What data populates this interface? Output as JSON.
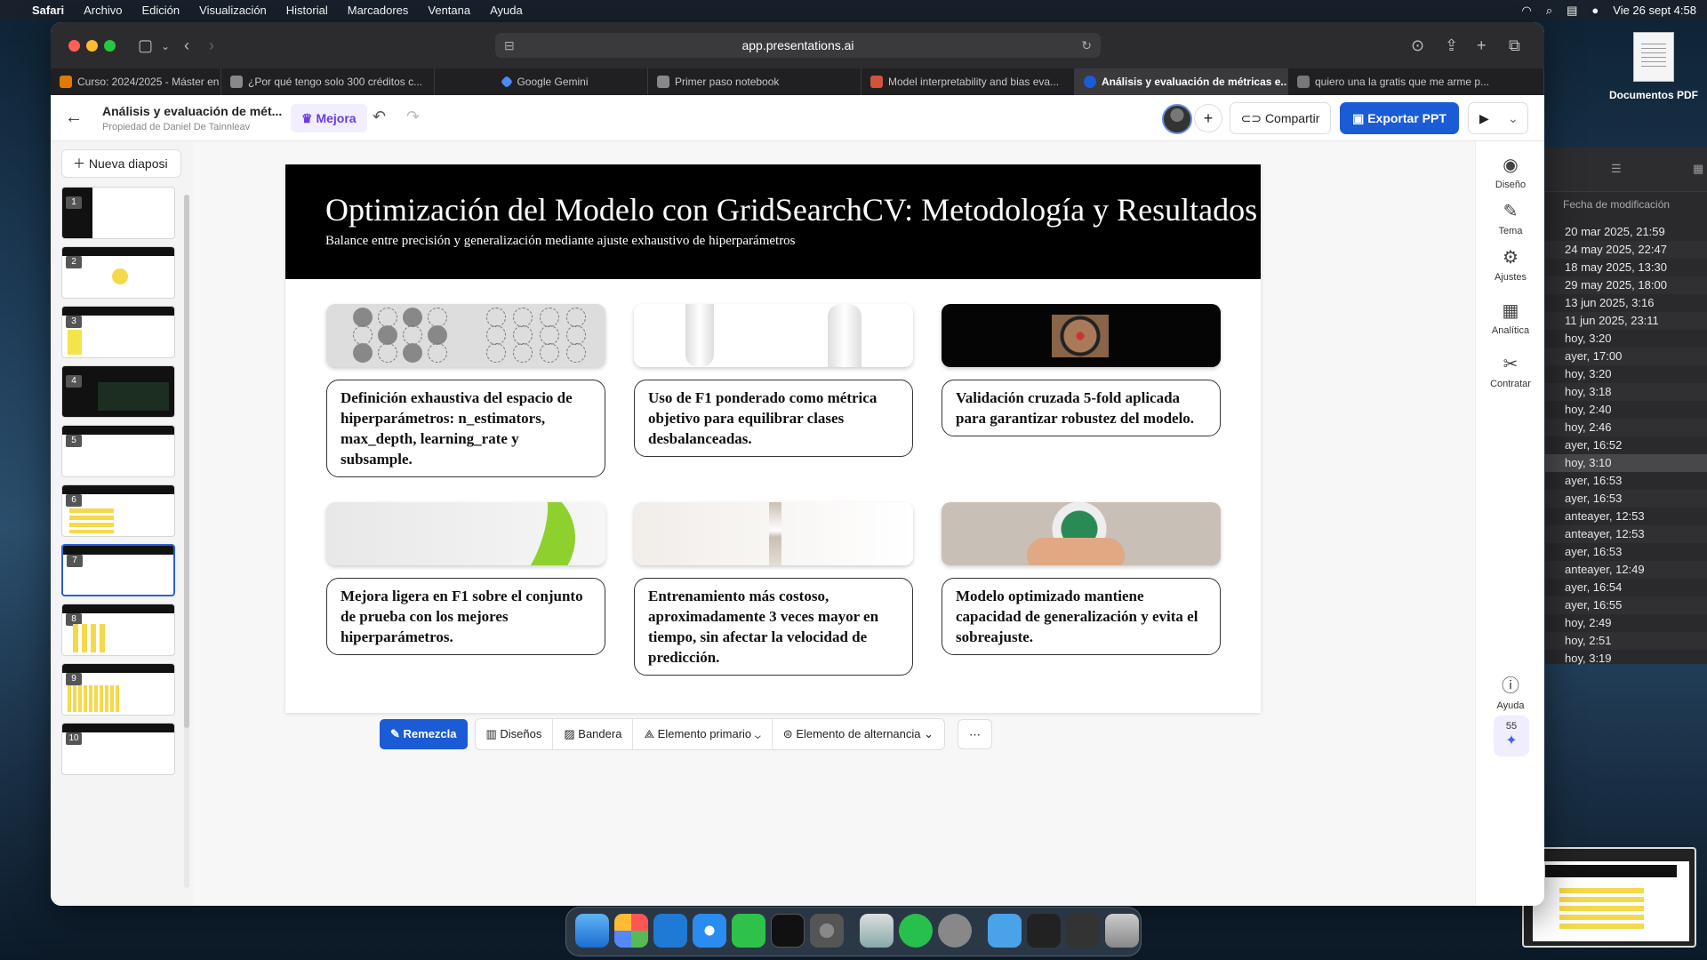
{
  "menubar": {
    "apple": "",
    "items": [
      "Safari",
      "Archivo",
      "Edición",
      "Visualización",
      "Historial",
      "Marcadores",
      "Ventana",
      "Ayuda"
    ],
    "datetime": "Vie 26 sept 4:58"
  },
  "desktop": {
    "file_label": "Documentos PDF"
  },
  "finder": {
    "column": "Fecha de modificación",
    "rows": [
      "20 mar 2025, 21:59",
      "24 may 2025, 22:47",
      "18 may 2025, 13:30",
      "29 may 2025, 18:00",
      "13 jun 2025, 3:16",
      "11 jun 2025, 23:11",
      "hoy, 3:20",
      "ayer, 17:00",
      "hoy, 3:20",
      "hoy, 3:18",
      "hoy, 2:40",
      "hoy, 2:46",
      "ayer, 16:52",
      "hoy, 3:10",
      "ayer, 16:53",
      "ayer, 16:53",
      "anteayer, 12:53",
      "anteayer, 12:53",
      "ayer, 16:53",
      "anteayer, 12:49",
      "ayer, 16:54",
      "ayer, 16:55",
      "hoy, 2:49",
      "hoy, 2:51",
      "hoy, 3:19"
    ]
  },
  "browser": {
    "url": "app.presentations.ai",
    "tabs": [
      {
        "label": "Curso: 2024/2025 - Máster en Dat...",
        "color": "#e07b00"
      },
      {
        "label": "¿Por qué tengo solo 300 créditos c...",
        "color": "#888888"
      },
      {
        "label": "Google Gemini",
        "color": "#4b8bf5"
      },
      {
        "label": "Primer paso notebook",
        "color": "#888888"
      },
      {
        "label": "Model interpretability and bias eva...",
        "color": "#d0543c"
      },
      {
        "label": "Análisis y evaluación de métricas e...",
        "color": "#1b5bd6"
      },
      {
        "label": "quiero una la gratis que me arme p...",
        "color": "#777777"
      }
    ]
  },
  "app": {
    "doc_title": "Análisis y evaluación de mét...",
    "doc_owner": "Propiedad de Daniel De Tainnleav",
    "mejora_label": "Mejora",
    "share_label": "Compartir",
    "export_label": "Exportar PPT",
    "new_slide_label": "Nueva diaposi",
    "slide_numbers": [
      "1",
      "2",
      "3",
      "4",
      "5",
      "6",
      "7",
      "8",
      "9",
      "10"
    ]
  },
  "slide": {
    "title": "Optimización del Modelo con GridSearchCV: Metodología y Resultados",
    "subtitle": "Balance entre precisión y generalización mediante ajuste exhaustivo de hiperparámetros",
    "cards": [
      "Definición exhaustiva del espacio de hiperparámetros: n_estimators, max_depth, learning_rate y subsample.",
      "Uso de F1 ponderado como métrica objetivo para equilibrar clases desbalanceadas.",
      "Validación cruzada 5-fold aplicada para garantizar robustez del modelo.",
      "Mejora ligera en F1 sobre el conjunto de prueba con los mejores hiperparámetros.",
      "Entrenamiento más costoso, aproximadamente 3 veces mayor en tiempo, sin afectar la velocidad de predicción.",
      "Modelo optimizado mantiene capacidad de generalización y evita el sobreajuste."
    ]
  },
  "bottom_toolbar": {
    "remix": "Remezcla",
    "designs": "Diseños",
    "flag": "Bandera",
    "primary": "Elemento primario",
    "alternate": "Elemento de alternancia",
    "more": "⋯"
  },
  "right_rail": {
    "items": [
      "Diseño",
      "Tema",
      "Ajustes",
      "Analítica",
      "Contratar"
    ],
    "help": "Ayuda",
    "credits": "55"
  }
}
